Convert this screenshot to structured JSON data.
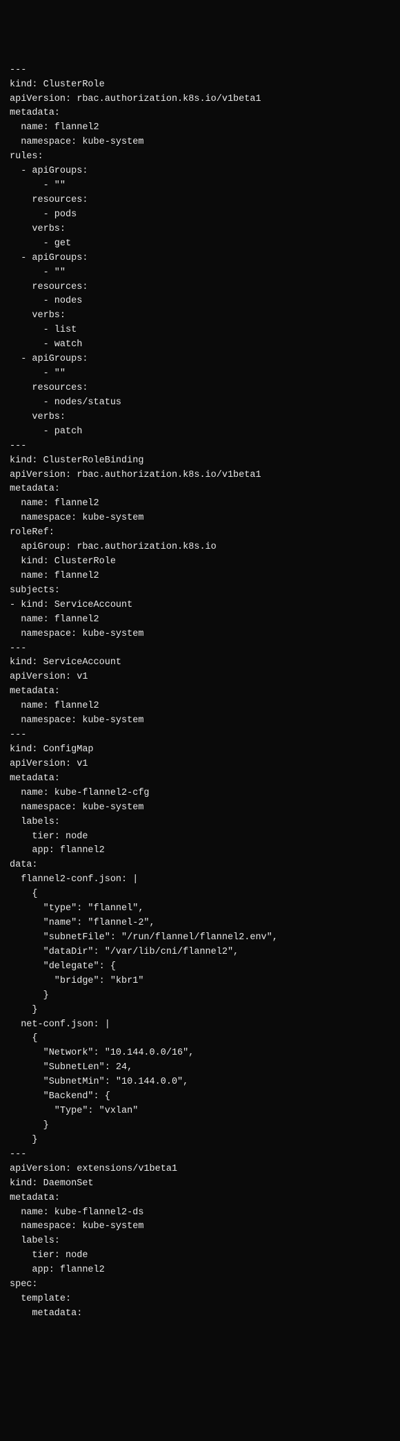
{
  "code": "---\nkind: ClusterRole\napiVersion: rbac.authorization.k8s.io/v1beta1\nmetadata:\n  name: flannel2\n  namespace: kube-system\nrules:\n  - apiGroups:\n      - \"\"\n    resources:\n      - pods\n    verbs:\n      - get\n  - apiGroups:\n      - \"\"\n    resources:\n      - nodes\n    verbs:\n      - list\n      - watch\n  - apiGroups:\n      - \"\"\n    resources:\n      - nodes/status\n    verbs:\n      - patch\n---\nkind: ClusterRoleBinding\napiVersion: rbac.authorization.k8s.io/v1beta1\nmetadata:\n  name: flannel2\n  namespace: kube-system\nroleRef:\n  apiGroup: rbac.authorization.k8s.io\n  kind: ClusterRole\n  name: flannel2\nsubjects:\n- kind: ServiceAccount\n  name: flannel2\n  namespace: kube-system\n---\nkind: ServiceAccount\napiVersion: v1\nmetadata:\n  name: flannel2\n  namespace: kube-system\n---\nkind: ConfigMap\napiVersion: v1\nmetadata:\n  name: kube-flannel2-cfg\n  namespace: kube-system\n  labels:\n    tier: node\n    app: flannel2\ndata:\n  flannel2-conf.json: |\n    {\n      \"type\": \"flannel\",\n      \"name\": \"flannel-2\",\n      \"subnetFile\": \"/run/flannel/flannel2.env\",\n      \"dataDir\": \"/var/lib/cni/flannel2\",\n      \"delegate\": {\n        \"bridge\": \"kbr1\"\n      }\n    }\n  net-conf.json: |\n    {\n      \"Network\": \"10.144.0.0/16\",\n      \"SubnetLen\": 24,\n      \"SubnetMin\": \"10.144.0.0\",\n      \"Backend\": {\n        \"Type\": \"vxlan\"\n      }\n    }\n---\napiVersion: extensions/v1beta1\nkind: DaemonSet\nmetadata:\n  name: kube-flannel2-ds\n  namespace: kube-system\n  labels:\n    tier: node\n    app: flannel2\nspec:\n  template:\n    metadata:"
}
